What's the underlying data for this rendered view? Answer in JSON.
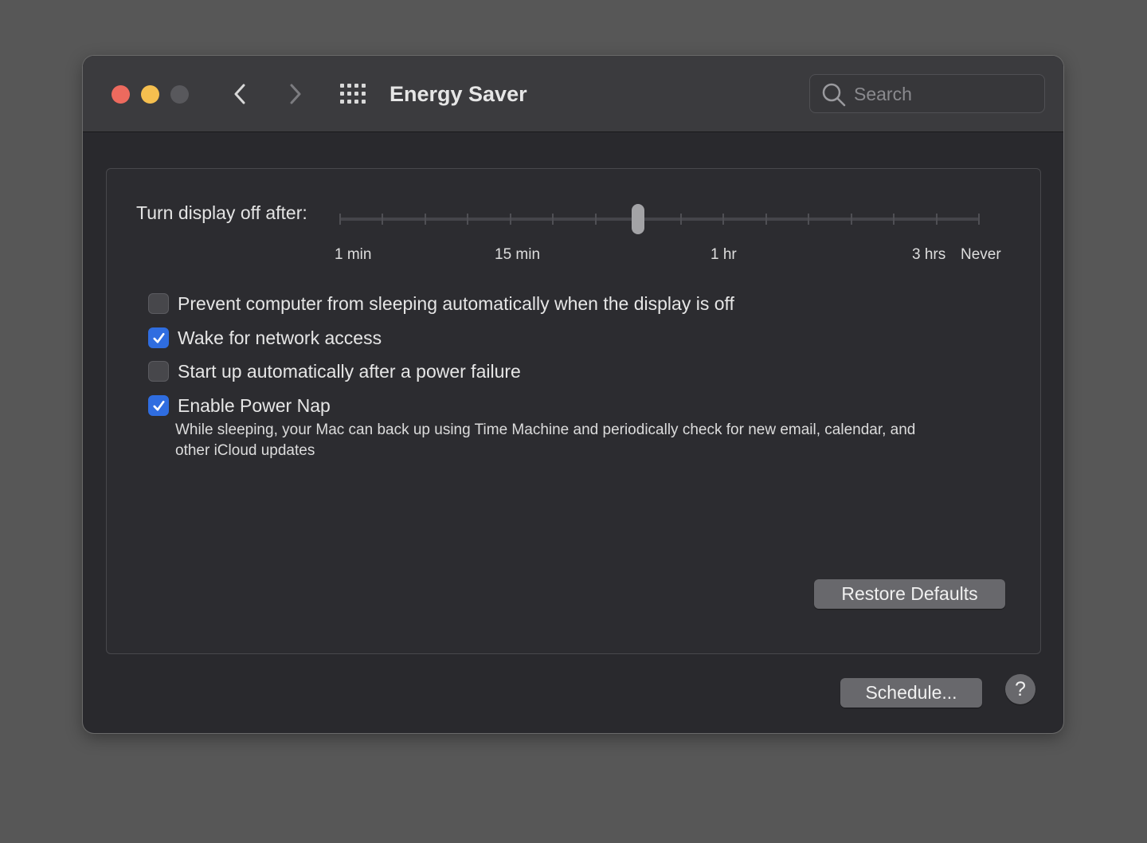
{
  "window": {
    "title": "Energy Saver"
  },
  "toolbar": {
    "back_icon": "chevron-left-icon",
    "forward_icon": "chevron-right-icon",
    "show_all_icon": "grid-icon"
  },
  "search": {
    "placeholder": "Search",
    "value": "",
    "icon": "search-icon"
  },
  "display_sleep": {
    "label": "Turn display off after:",
    "scale_labels": [
      "1 min",
      "15 min",
      "1 hr",
      "3 hrs",
      "Never"
    ],
    "tick_count": 16,
    "selected_tick_index": 7
  },
  "options": [
    {
      "label": "Prevent computer from sleeping automatically when the display is off",
      "checked": false
    },
    {
      "label": "Wake for network access",
      "checked": true
    },
    {
      "label": "Start up automatically after a power failure",
      "checked": false
    },
    {
      "label": "Enable Power Nap",
      "checked": true
    }
  ],
  "power_nap_description": "While sleeping, your Mac can back up using Time Machine and periodically check for new email, calendar, and other iCloud updates",
  "buttons": {
    "restore_defaults": "Restore Defaults",
    "schedule": "Schedule...",
    "help": "?"
  },
  "colors": {
    "close": "#ed6a5e",
    "minimize": "#f5bf4f",
    "zoom_disabled": "#58585c",
    "accent": "#2f6de0"
  }
}
